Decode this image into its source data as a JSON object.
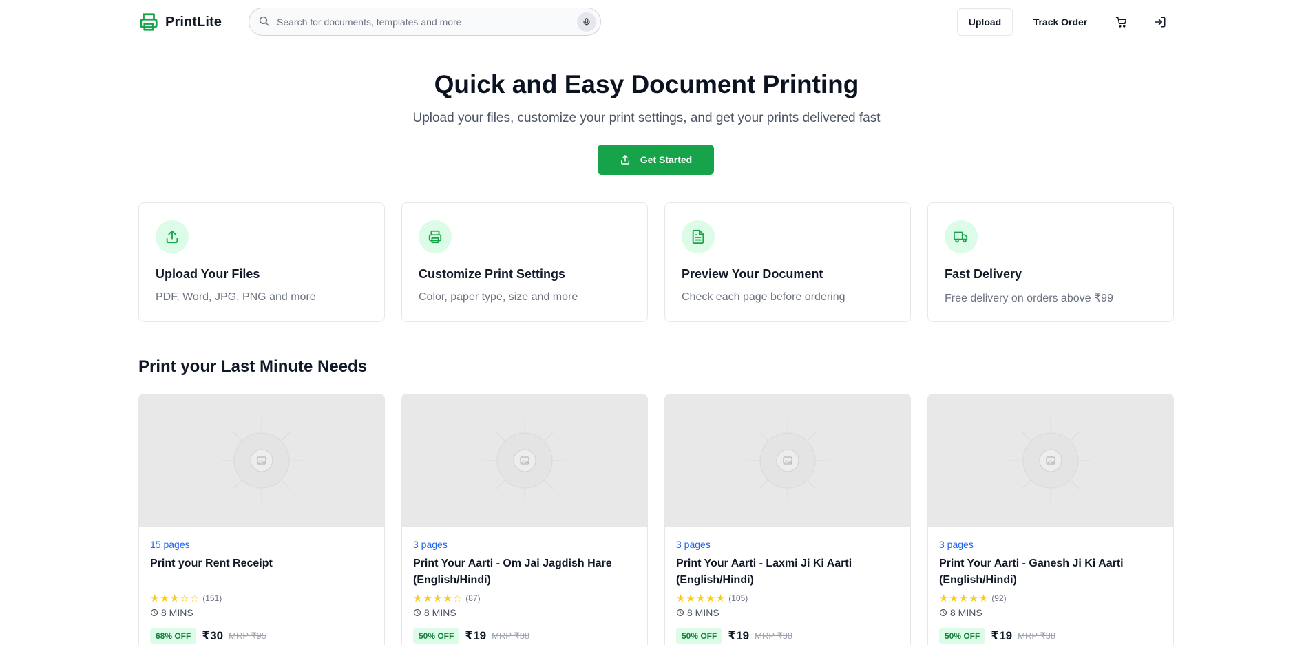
{
  "header": {
    "brand": "PrintLite",
    "search_placeholder": "Search for documents, templates and more",
    "upload_label": "Upload",
    "track_order_label": "Track Order",
    "icons": [
      "printer-icon",
      "search-icon",
      "mic-icon",
      "cart-icon",
      "login-icon"
    ]
  },
  "hero": {
    "title": "Quick and Easy Document Printing",
    "subtitle": "Upload your files, customize your print settings, and get your prints delivered fast",
    "cta_label": "Get Started"
  },
  "features": [
    {
      "icon": "upload-icon",
      "title": "Upload Your Files",
      "desc": "PDF, Word, JPG, PNG and more"
    },
    {
      "icon": "printer-icon",
      "title": "Customize Print Settings",
      "desc": "Color, paper type, size and more"
    },
    {
      "icon": "document-icon",
      "title": "Preview Your Document",
      "desc": "Check each page before ordering"
    },
    {
      "icon": "truck-icon",
      "title": "Fast Delivery",
      "desc": "Free delivery on orders above ₹99"
    }
  ],
  "section": {
    "title": "Print your Last Minute Needs"
  },
  "products": [
    {
      "pages": "15 pages",
      "title": "Print your Rent Receipt",
      "rating": 3,
      "stars": "★★★☆☆",
      "reviews": "(151)",
      "time": "8 MINS",
      "off": "68% OFF",
      "price": "₹30",
      "mrp": "MRP ₹95"
    },
    {
      "pages": "3 pages",
      "title": "Print Your Aarti - Om Jai Jagdish Hare (English/Hindi)",
      "rating": 4,
      "stars": "★★★★☆",
      "reviews": "(87)",
      "time": "8 MINS",
      "off": "50% OFF",
      "price": "₹19",
      "mrp": "MRP ₹38"
    },
    {
      "pages": "3 pages",
      "title": "Print Your Aarti - Laxmi Ji Ki Aarti (English/Hindi)",
      "rating": 4.5,
      "stars": "★★★★★",
      "reviews": "(105)",
      "time": "8 MINS",
      "off": "50% OFF",
      "price": "₹19",
      "mrp": "MRP ₹38"
    },
    {
      "pages": "3 pages",
      "title": "Print Your Aarti - Ganesh Ji Ki Aarti (English/Hindi)",
      "rating": 5,
      "stars": "★★★★★",
      "reviews": "(92)",
      "time": "8 MINS",
      "off": "50% OFF",
      "price": "₹19",
      "mrp": "MRP ₹38"
    }
  ],
  "colors": {
    "accent": "#16a34a",
    "accent_light": "#dcfce7",
    "link": "#2563eb",
    "star": "#facc15"
  }
}
